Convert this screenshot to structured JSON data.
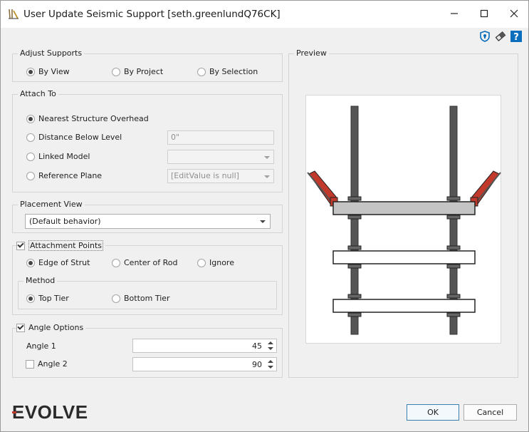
{
  "window": {
    "title": "User Update Seismic Support [seth.greenlundQ76CK]",
    "controls": {
      "minimize": "–",
      "maximize": "□",
      "close": "✕"
    }
  },
  "toolbar_icons": [
    "shield-icon",
    "eraser-icon",
    "help-icon"
  ],
  "adjust_supports": {
    "legend": "Adjust Supports",
    "options": [
      "By View",
      "By Project",
      "By Selection"
    ],
    "selected": "By View"
  },
  "attach_to": {
    "legend": "Attach To",
    "options": [
      "Nearest Structure Overhead",
      "Distance Below Level",
      "Linked Model",
      "Reference Plane"
    ],
    "selected": "Nearest Structure Overhead",
    "distance_value": "0\"",
    "linked_model_value": "",
    "reference_plane_value": "[EditValue is null]"
  },
  "placement_view": {
    "legend": "Placement View",
    "value": "(Default behavior)"
  },
  "attachment_points": {
    "legend": "Attachment Points",
    "checked": true,
    "options": [
      "Edge of Strut",
      "Center of Rod",
      "Ignore"
    ],
    "selected": "Edge of Strut",
    "method": {
      "legend": "Method",
      "options": [
        "Top Tier",
        "Bottom Tier"
      ],
      "selected": "Top Tier"
    }
  },
  "angle_options": {
    "legend": "Angle Options",
    "checked": true,
    "angle1_label": "Angle 1",
    "angle1_value": "45",
    "angle2_label": "Angle 2",
    "angle2_checked": false,
    "angle2_value": "90"
  },
  "preview": {
    "legend": "Preview"
  },
  "logo": {
    "text": "EVOLVE"
  },
  "buttons": {
    "ok": "OK",
    "cancel": "Cancel"
  },
  "colors": {
    "brace": "#c0392b",
    "strut_fill": "#c4c4c4",
    "rod": "#555555",
    "accent": "#0a6ebd"
  }
}
